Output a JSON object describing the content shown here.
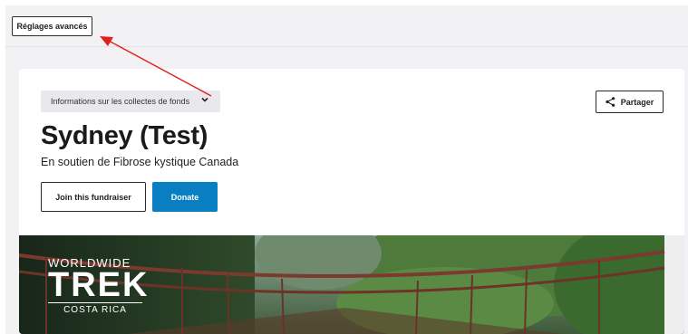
{
  "toolbar": {
    "advanced_settings_label": "Réglages avancés"
  },
  "fundraiser": {
    "info_dropdown_label": "Informations sur les collectes de fonds",
    "share_label": "Partager",
    "title": "Sydney (Test)",
    "subtitle": "En soutien de Fibrose kystique Canada",
    "join_label": "Join this fundraiser",
    "donate_label": "Donate"
  },
  "hero": {
    "logo_line1": "WORLDWIDE",
    "logo_line2": "TREK",
    "logo_line3": "COSTA RICA"
  },
  "colors": {
    "accent": "#0a7ec2",
    "annotation_arrow": "#e0201c"
  },
  "icons": {
    "share": "share-icon",
    "dropdown": "chevron-down-icon"
  }
}
